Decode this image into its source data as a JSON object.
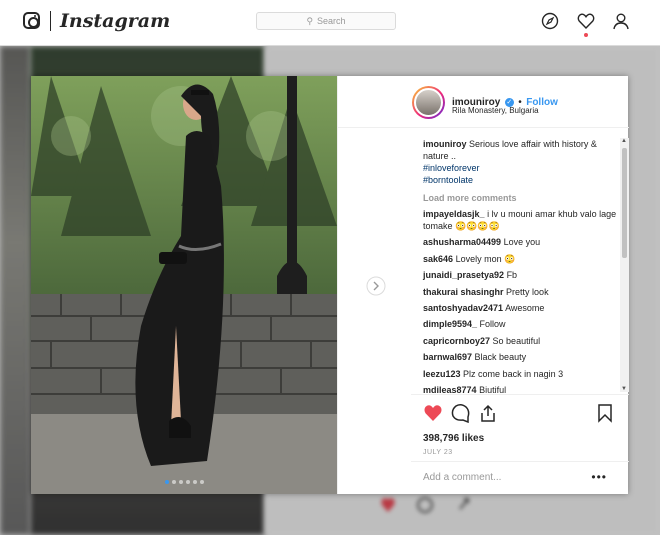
{
  "nav": {
    "logo_text": "Instagram",
    "search_placeholder": "Search",
    "icons": [
      "instagram-camera-icon",
      "compass-icon",
      "heart-icon",
      "profile-icon"
    ]
  },
  "post": {
    "username": "imouniroy",
    "follow_label": "Follow",
    "separator": "•",
    "location": "Rila Monastery, Bulgaria",
    "caption": {
      "user": "imouniroy",
      "text": "Serious love affair with history & nature ..",
      "hashtags": [
        "#inloveforever",
        "#borntoolate"
      ]
    },
    "load_more_label": "Load more comments",
    "comments": [
      {
        "user": "impayeldasjk_",
        "text": "i lv u mouni amar khub valo lage tomake 😳😳😳😳"
      },
      {
        "user": "ashusharma04499",
        "text": "Love you"
      },
      {
        "user": "sak646",
        "text": "Lovely mon 😳"
      },
      {
        "user": "junaidi_prasetya92",
        "text": "Fb"
      },
      {
        "user": "thakurai shasinghr",
        "text": "Pretty look"
      },
      {
        "user": "santoshyadav2471",
        "text": "Awesome"
      },
      {
        "user": "dimple9594_",
        "text": "Follow"
      },
      {
        "user": "capricornboy27",
        "text": "So beautiful"
      },
      {
        "user": "barnwal697",
        "text": "Black beauty"
      },
      {
        "user": "leezu123",
        "text": "Plz come back in nagin 3"
      },
      {
        "user": "mdileas8774",
        "text": "Biutiful"
      }
    ],
    "likes": "398,796 likes",
    "date": "JULY 23",
    "add_comment_placeholder": "Add a comment...",
    "more_options": "•••",
    "carousel": {
      "count": 6,
      "active_index": 0
    },
    "colors": {
      "accent": "#3897f0",
      "like_red": "#ed4956",
      "hashtag": "#003569"
    }
  }
}
